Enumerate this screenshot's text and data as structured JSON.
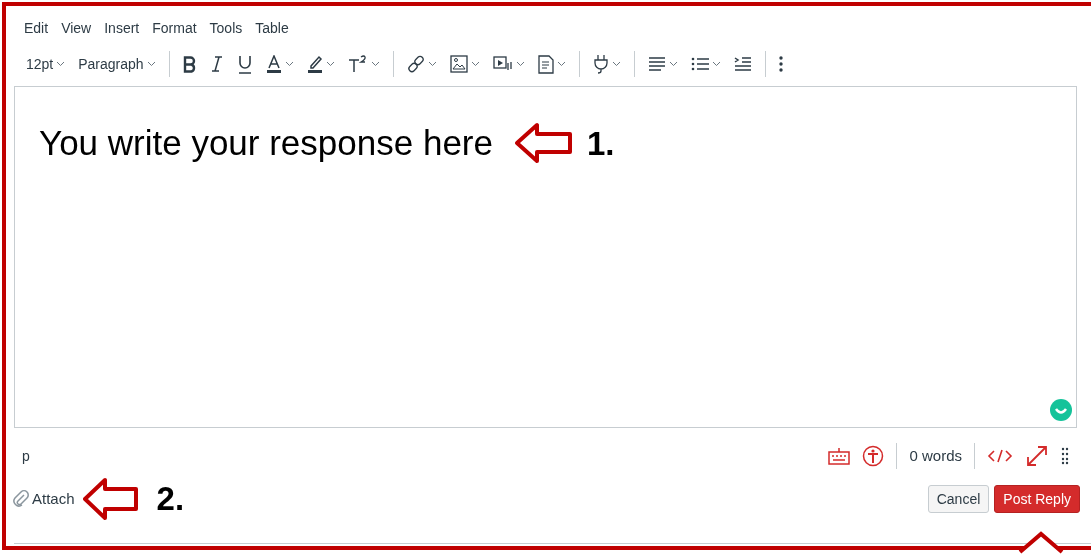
{
  "menu": [
    "Edit",
    "View",
    "Insert",
    "Format",
    "Tools",
    "Table"
  ],
  "toolbar": [
    {
      "kind": "dropdown",
      "label": "12pt"
    },
    {
      "kind": "dropdown",
      "label": "Paragraph"
    },
    {
      "kind": "separator"
    },
    {
      "kind": "bold"
    },
    {
      "kind": "italic"
    },
    {
      "kind": "underline"
    },
    {
      "kind": "textcolor"
    },
    {
      "kind": "highlight"
    },
    {
      "kind": "superscript"
    },
    {
      "kind": "separator"
    },
    {
      "kind": "link"
    },
    {
      "kind": "image"
    },
    {
      "kind": "media"
    },
    {
      "kind": "document"
    },
    {
      "kind": "separator"
    },
    {
      "kind": "plug"
    },
    {
      "kind": "separator"
    },
    {
      "kind": "align"
    },
    {
      "kind": "list"
    },
    {
      "kind": "indent"
    },
    {
      "kind": "separator"
    },
    {
      "kind": "more"
    }
  ],
  "editor": {
    "text": "You write your response here",
    "annotation": "1."
  },
  "status_bar": {
    "path": "p",
    "word_count": "0 words"
  },
  "footer": {
    "attach": "Attach",
    "annotation": "2.",
    "buttons": [
      {
        "kind": "secondary",
        "label": "Cancel"
      },
      {
        "kind": "primary",
        "label": "Post Reply"
      }
    ]
  }
}
